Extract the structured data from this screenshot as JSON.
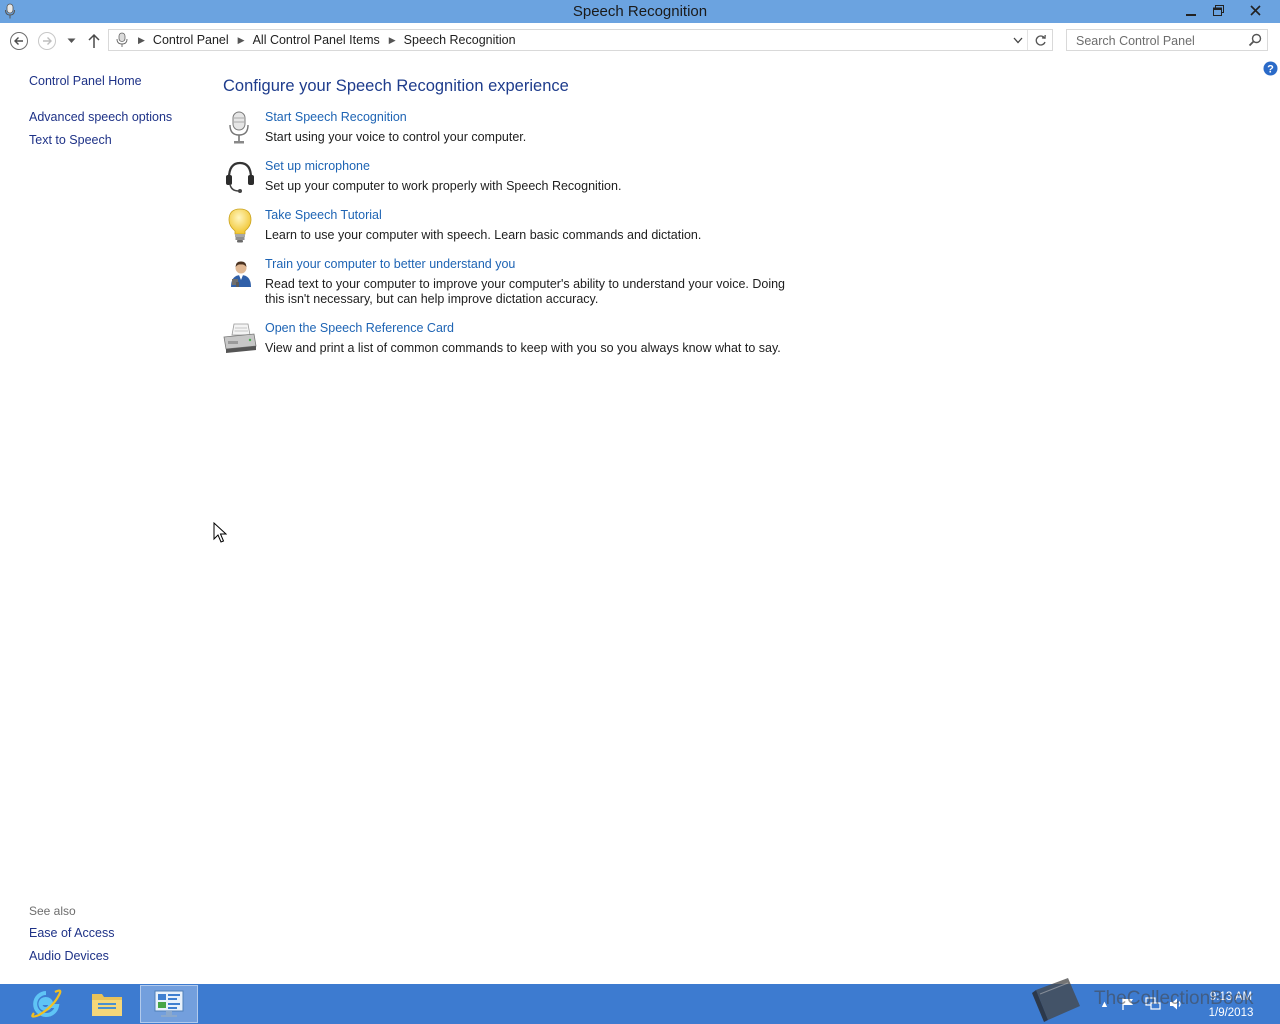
{
  "window": {
    "title": "Speech Recognition"
  },
  "navigation": {
    "breadcrumbs": [
      "Control Panel",
      "All Control Panel Items",
      "Speech Recognition"
    ],
    "search_placeholder": "Search Control Panel"
  },
  "left_pane": {
    "home": "Control Panel Home",
    "links": [
      "Advanced speech options",
      "Text to Speech"
    ],
    "see_also_heading": "See also",
    "see_also": [
      "Ease of Access",
      "Audio Devices"
    ]
  },
  "main": {
    "heading": "Configure your Speech Recognition experience",
    "tasks": [
      {
        "icon": "microphone-icon",
        "link": "Start Speech Recognition",
        "description": "Start using your voice to control your computer."
      },
      {
        "icon": "headset-icon",
        "link": "Set up microphone",
        "description": "Set up your computer to work properly with Speech Recognition."
      },
      {
        "icon": "lightbulb-icon",
        "link": "Take Speech Tutorial",
        "description": "Learn to use your computer with speech.  Learn basic commands and dictation."
      },
      {
        "icon": "user-training-icon",
        "link": "Train your computer to better understand you",
        "description": "Read text to your computer to improve your computer's ability to understand your voice.  Doing this isn't necessary, but can help improve dictation accuracy."
      },
      {
        "icon": "printer-icon",
        "link": "Open the Speech Reference Card",
        "description": "View and print a list of common commands to keep with you so you always know what to say."
      }
    ]
  },
  "taskbar": {
    "time": "9:13 AM",
    "date": "1/9/2013",
    "watermark": "TheCollectionBook"
  },
  "colors": {
    "titlebar": "#6ba3e0",
    "taskbar": "#3d7bd0",
    "link": "#1e64b4",
    "heading": "#1e3c8c"
  }
}
